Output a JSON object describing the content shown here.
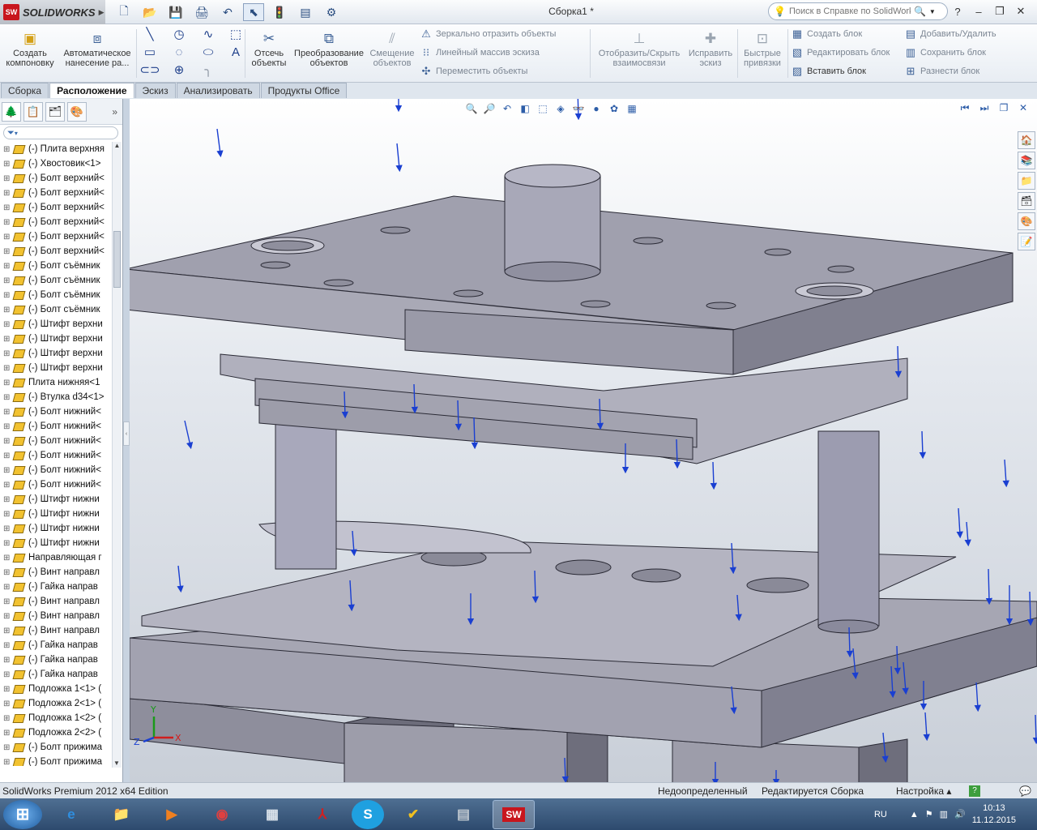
{
  "app": {
    "logo_text": "SOLIDWORKS",
    "logo_badge": "SW",
    "document_title": "Сборка1 *"
  },
  "help": {
    "placeholder": "Поиск в Справке по SolidWorks"
  },
  "ribbon": {
    "create_layout": "Создать компоновку",
    "auto_dimension": "Автоматическое нанесение ра...",
    "trim": "Отсечь объекты",
    "convert": "Преобразование объектов",
    "offset": "Смещение объектов",
    "mirror": "Зеркально отразить объекты",
    "linear_pattern": "Линейный массив эскиза",
    "move": "Переместить объекты",
    "show_hide": "Отобразить/Скрыть взаимосвязи",
    "repair": "Исправить эскиз",
    "quick_snaps": "Быстрые привязки",
    "create_block": "Создать блок",
    "edit_block": "Редактировать блок",
    "insert_block": "Вставить блок",
    "add_remove": "Добавить/Удалить",
    "save_block": "Сохранить блок",
    "explode_block": "Разнести блок"
  },
  "tabs": [
    {
      "label": "Сборка",
      "active": false
    },
    {
      "label": "Расположение",
      "active": true
    },
    {
      "label": "Эскиз",
      "active": false
    },
    {
      "label": "Анализировать",
      "active": false
    },
    {
      "label": "Продукты Office",
      "active": false
    }
  ],
  "tree_items": [
    "(-) Плита верхняя",
    "(-) Хвостовик<1>",
    "(-) Болт верхний<",
    "(-) Болт верхний<",
    "(-) Болт верхний<",
    "(-) Болт верхний<",
    "(-) Болт верхний<",
    "(-) Болт верхний<",
    "(-) Болт съёмник",
    "(-) Болт съёмник",
    "(-) Болт съёмник",
    "(-) Болт съёмник",
    "(-) Штифт верхни",
    "(-) Штифт верхни",
    "(-) Штифт верхни",
    "(-) Штифт верхни",
    "Плита нижняя<1",
    "(-) Втулка d34<1>",
    "(-) Болт нижний<",
    "(-) Болт нижний<",
    "(-) Болт нижний<",
    "(-) Болт нижний<",
    "(-) Болт нижний<",
    "(-) Болт нижний<",
    "(-) Штифт нижни",
    "(-) Штифт нижни",
    "(-) Штифт нижни",
    "(-) Штифт нижни",
    "Направляющая г",
    "(-) Винт направл",
    "(-) Гайка направ",
    "(-) Винт направл",
    "(-) Винт направл",
    "(-) Винт направл",
    "(-) Гайка направ",
    "(-) Гайка направ",
    "(-) Гайка направ",
    "Подложка 1<1> (",
    "Подложка 2<1> (",
    "Подложка 1<2> (",
    "Подложка 2<2> (",
    "(-) Болт прижима",
    "(-) Болт прижима"
  ],
  "triad": {
    "x": "X",
    "y": "Y",
    "z": "Z"
  },
  "status": {
    "edition": "SolidWorks Premium 2012 x64 Edition",
    "definition": "Недоопределенный",
    "editing": "Редактируется Сборка",
    "custom": "Настройка"
  },
  "taskbar": {
    "lang": "RU",
    "time": "10:13",
    "date": "11.12.2015"
  },
  "colors": {
    "accent_blue": "#1a3fd1",
    "model_gray": "#9b9ba8"
  }
}
